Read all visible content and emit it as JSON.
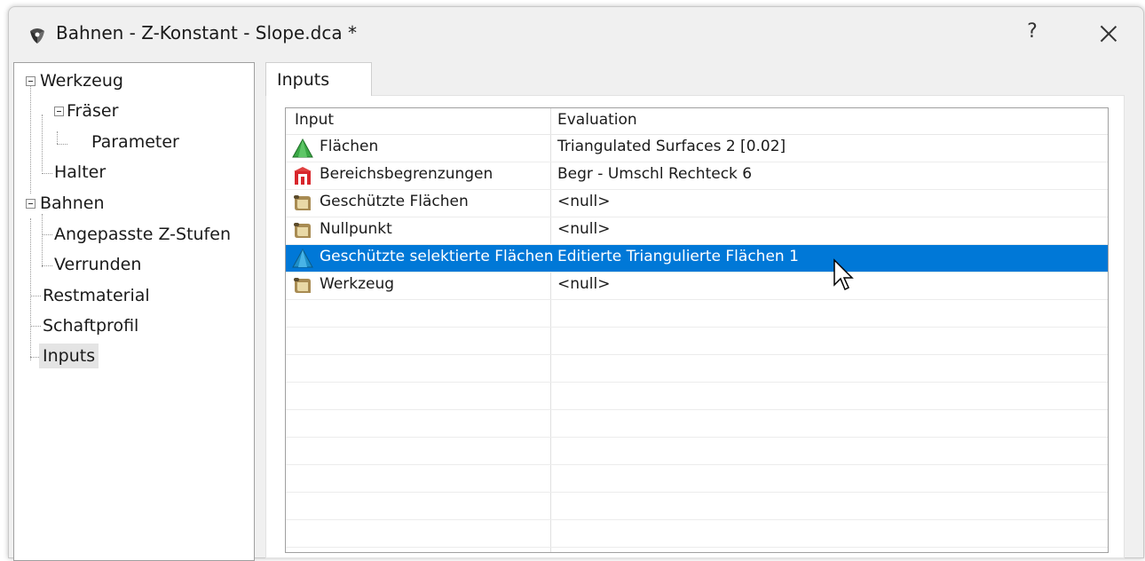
{
  "window": {
    "title": "Bahnen - Z-Konstant - Slope.dca *",
    "help_label": "?",
    "close_icon": "close-icon"
  },
  "tree": {
    "items": [
      {
        "label": "Werkzeug",
        "level": 0,
        "expandable": true
      },
      {
        "label": "Fräser",
        "level": 1,
        "expandable": true
      },
      {
        "label": "Parameter",
        "level": 2,
        "expandable": false
      },
      {
        "label": "Halter",
        "level": 1,
        "expandable": false
      },
      {
        "label": "Bahnen",
        "level": 0,
        "expandable": true
      },
      {
        "label": "Angepasste Z-Stufen",
        "level": 1,
        "expandable": false
      },
      {
        "label": "Verrunden",
        "level": 1,
        "expandable": false
      },
      {
        "label": "Restmaterial",
        "level": 0,
        "expandable": false
      },
      {
        "label": "Schaftprofil",
        "level": 0,
        "expandable": false
      },
      {
        "label": "Inputs",
        "level": 0,
        "expandable": false,
        "selected": true
      }
    ]
  },
  "tab": {
    "label": "Inputs"
  },
  "grid": {
    "columns": [
      "Input",
      "Evaluation"
    ],
    "rows": [
      {
        "input": "Flächen",
        "evaluation": "Triangulated Surfaces 2 [0.02]",
        "icon": "green-triangle-icon"
      },
      {
        "input": "Bereichsbegrenzungen",
        "evaluation": "Begr - Umschl Rechteck 6",
        "icon": "boundary-icon"
      },
      {
        "input": "Geschützte Flächen",
        "evaluation": "<null>",
        "icon": "scroll-icon"
      },
      {
        "input": "Nullpunkt",
        "evaluation": "<null>",
        "icon": "scroll-icon"
      },
      {
        "input": "Geschützte selektierte Flächen",
        "evaluation": "Editierte Triangulierte Flächen 1",
        "icon": "blue-triangle-icon",
        "selected": true
      },
      {
        "input": "Werkzeug",
        "evaluation": "<null>",
        "icon": "scroll-icon"
      }
    ],
    "selection_color": "#0078d7"
  }
}
